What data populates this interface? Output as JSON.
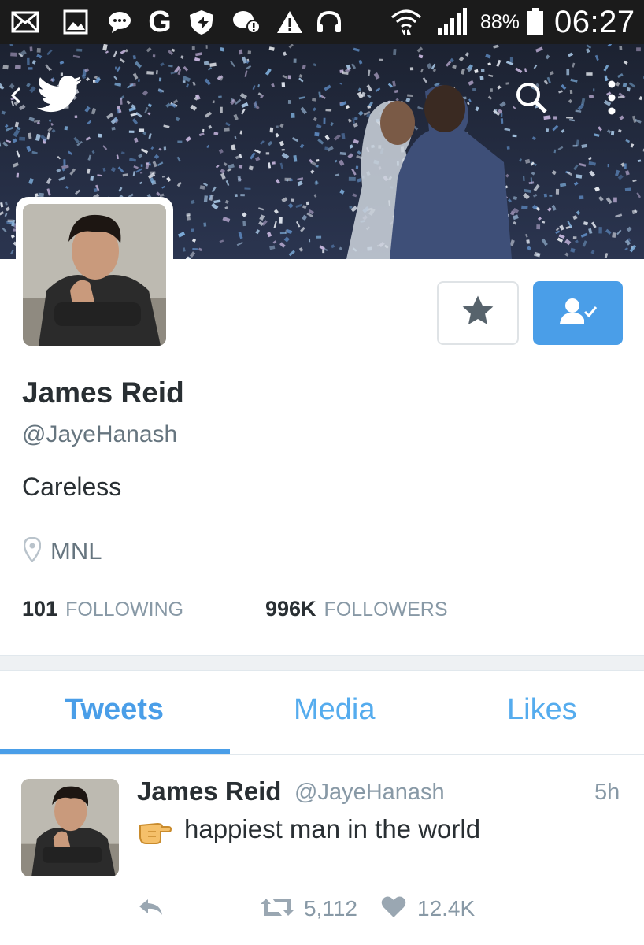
{
  "status_bar": {
    "battery_percent": "88%",
    "time": "06:27",
    "icons": [
      "mail-icon",
      "gallery-icon",
      "chat-bubble-icon",
      "google-icon",
      "shield-icon",
      "messenger-icon",
      "warning-icon",
      "headphones-icon",
      "wifi-icon",
      "signal-icon",
      "battery-icon"
    ]
  },
  "header": {
    "icons": [
      "back-icon",
      "twitter-bird-icon",
      "search-icon",
      "more-vertical-icon"
    ]
  },
  "profile": {
    "name": "James Reid",
    "handle": "@JayeHanash",
    "bio": "Careless",
    "location": "MNL",
    "following_count": "101",
    "following_label": "FOLLOWING",
    "followers_count": "996K",
    "followers_label": "FOLLOWERS"
  },
  "buttons": {
    "star_icon": "star-icon",
    "following_icon": "user-check-icon"
  },
  "tabs": [
    {
      "label": "Tweets",
      "active": true
    },
    {
      "label": "Media",
      "active": false
    },
    {
      "label": "Likes",
      "active": false
    }
  ],
  "tweet": {
    "name": "James Reid",
    "handle": "@JayeHanash",
    "time": "5h",
    "text": "happiest man in the world",
    "emoji": "pointing-hand-emoji",
    "retweets": "5,112",
    "likes": "12.4K"
  },
  "colors": {
    "accent": "#4a9ee8",
    "muted_text": "#8899a6",
    "status_bar": "#1b1b1b"
  }
}
